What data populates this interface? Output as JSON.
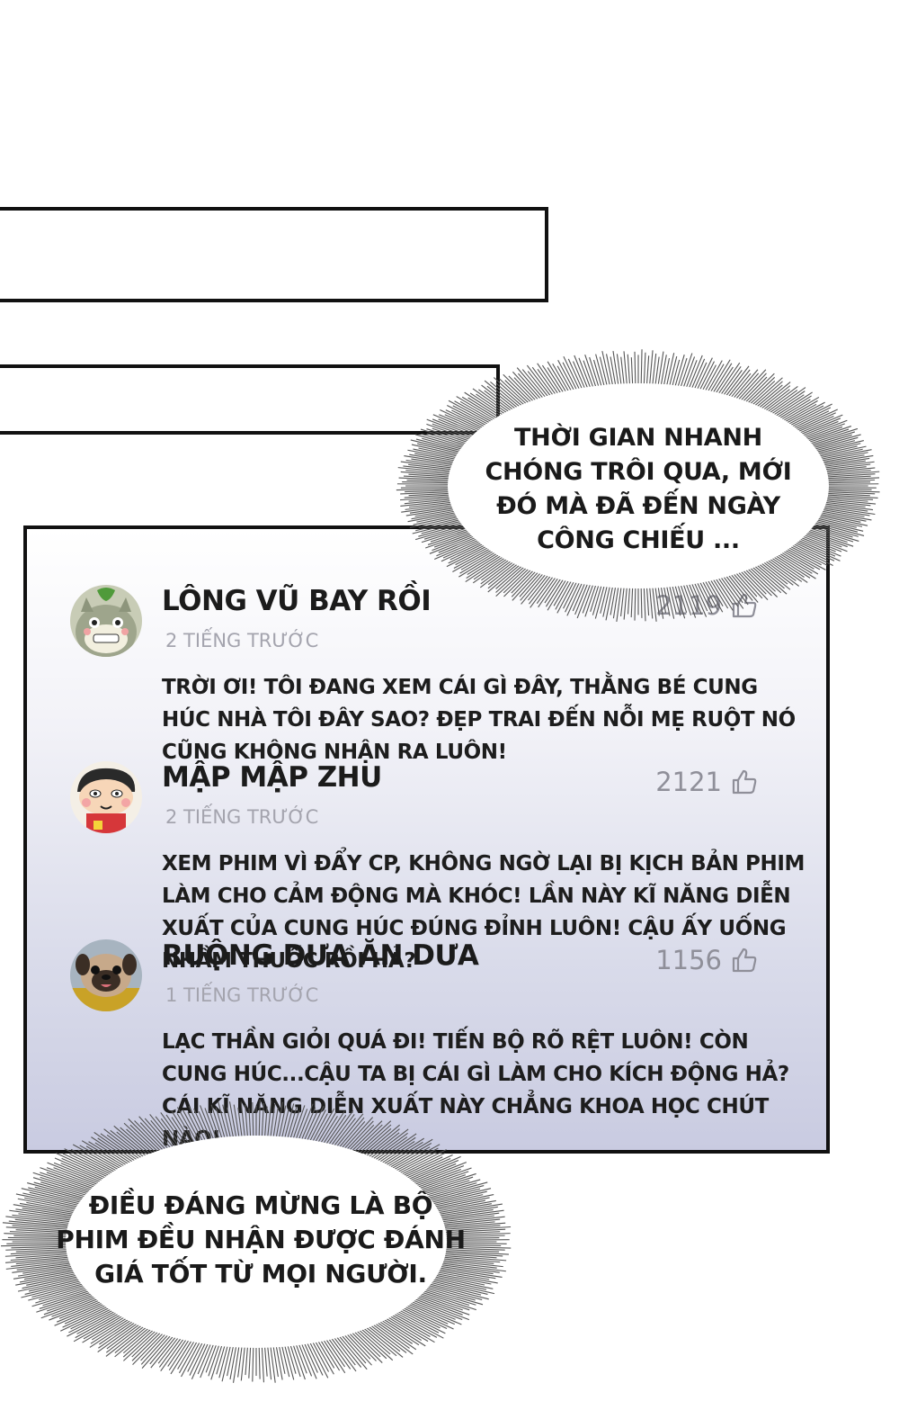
{
  "bubbles": {
    "top": [
      "THỜI GIAN NHANH",
      "CHÓNG TRÔI QUA, MỚI",
      "ĐÓ MÀ ĐÃ ĐẾN NGÀY",
      "CÔNG CHIẾU ..."
    ],
    "bottom": [
      "ĐIỀU ĐÁNG MỪNG LÀ BỘ",
      "PHIM ĐỀU NHẬN ĐƯỢC ĐÁNH",
      "GIÁ TỐT TỪ MỌI NGƯỜI."
    ]
  },
  "comments": [
    {
      "username": "LÔNG VŨ BAY RỒI",
      "time": "2 TIẾNG TRƯỚC",
      "likes": "2119",
      "text": "TRỜI ƠI! TÔI ĐANG XEM CÁI GÌ ĐÂY, THẰNG BÉ CUNG HÚC NHÀ TÔI ĐÂY SAO? ĐẸP TRAI ĐẾN NỖI MẸ RUỘT NÓ CŨNG KHÔNG NHẬN RA LUÔN!",
      "avatar": "totoro-avatar"
    },
    {
      "username": "MẬP MẬP ZHU",
      "time": "2 TIẾNG TRƯỚC",
      "likes": "2121",
      "text": "XEM PHIM VÌ ĐẨY CP, KHÔNG NGỜ LẠI BỊ KỊCH BẢN PHIM LÀM CHO CẢM ĐỘNG MÀ KHÓC! LẦN NÀY KĨ NĂNG DIỄN XUẤT CỦA CUNG HÚC ĐÚNG ĐỈNH LUÔN! CẬU ẤY UỐNG NHẦM THUỐC RỒI HẢ?",
      "avatar": "shinchan-avatar"
    },
    {
      "username": "RUỘNG DƯA ĂN DƯA",
      "time": "1 TIẾNG TRƯỚC",
      "likes": "1156",
      "text": "LẠC THẦN GIỎI QUÁ ĐI! TIẾN BỘ RÕ RỆT LUÔN! CÒN CUNG HÚC...CẬU TA BỊ CÁI GÌ LÀM CHO KÍCH ĐỘNG HẢ? CÁI KĨ NĂNG DIỄN XUẤT NÀY CHẲNG KHOA HỌC CHÚT NÀO!",
      "avatar": "pug-avatar"
    }
  ],
  "icons": {
    "like": "thumbs-up-icon"
  },
  "colors": {
    "panel_bottom": "#c9cbe1",
    "username": "#1b1b1b",
    "meta": "#a4a4ae"
  }
}
